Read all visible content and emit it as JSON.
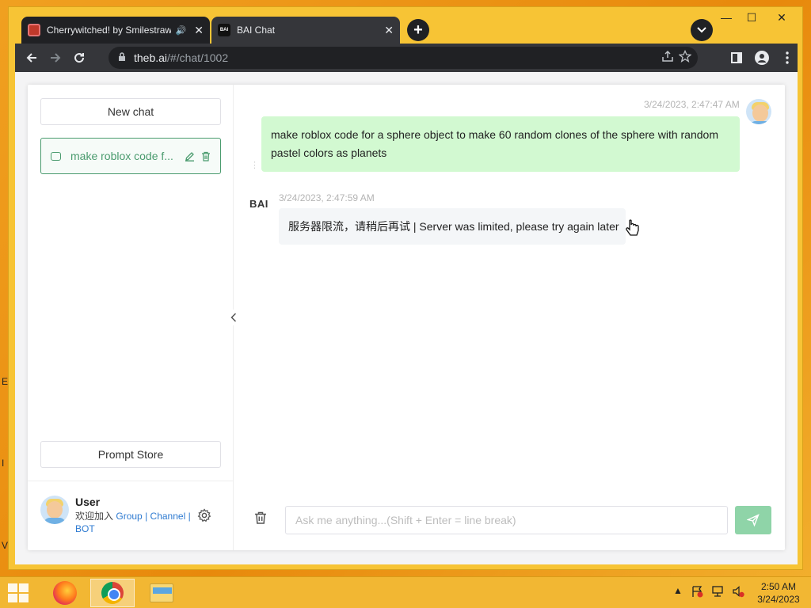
{
  "desktop": {
    "edge_letters": [
      "E",
      "I",
      "V"
    ]
  },
  "browser": {
    "tabs": [
      {
        "title": "Cherrywitched! by Smilestraw",
        "speaker": "🔊",
        "close": "✕"
      },
      {
        "title": "BAI Chat",
        "favicon_text": "BAI",
        "close": "✕"
      }
    ],
    "new_tab": "+",
    "window_controls": {
      "minimize": "—",
      "maximize": "☐",
      "close": "✕"
    },
    "url_host": "theb.ai",
    "url_path": "/#/chat/1002"
  },
  "sidebar": {
    "new_chat_label": "New chat",
    "history": [
      {
        "label": "make roblox code f..."
      }
    ],
    "prompt_store_label": "Prompt Store",
    "user": {
      "name": "User",
      "welcome": "欢迎加入",
      "links": [
        "Group",
        "Channel",
        "BOT"
      ],
      "separator": "|"
    }
  },
  "chat": {
    "messages": [
      {
        "role": "user",
        "time": "3/24/2023, 2:47:47 AM",
        "text": "make roblox code for a sphere object to make 60 random clones of the sphere with random pastel colors as planets"
      },
      {
        "role": "bot",
        "bot_name": "BAI",
        "time": "3/24/2023, 2:47:59 AM",
        "text": "服务器限流，请稍后再试 | Server was limited, please try again later"
      }
    ],
    "input_placeholder": "Ask me anything...(Shift + Enter = line break)"
  },
  "taskbar": {
    "clock_time": "2:50 AM",
    "clock_date": "3/24/2023",
    "tray_arrow": "▲"
  },
  "colors": {
    "accent_green": "#4a9b6e",
    "user_bubble": "#d2f9d1",
    "send_button": "#8fd4a8",
    "desktop": "#f0a020"
  }
}
